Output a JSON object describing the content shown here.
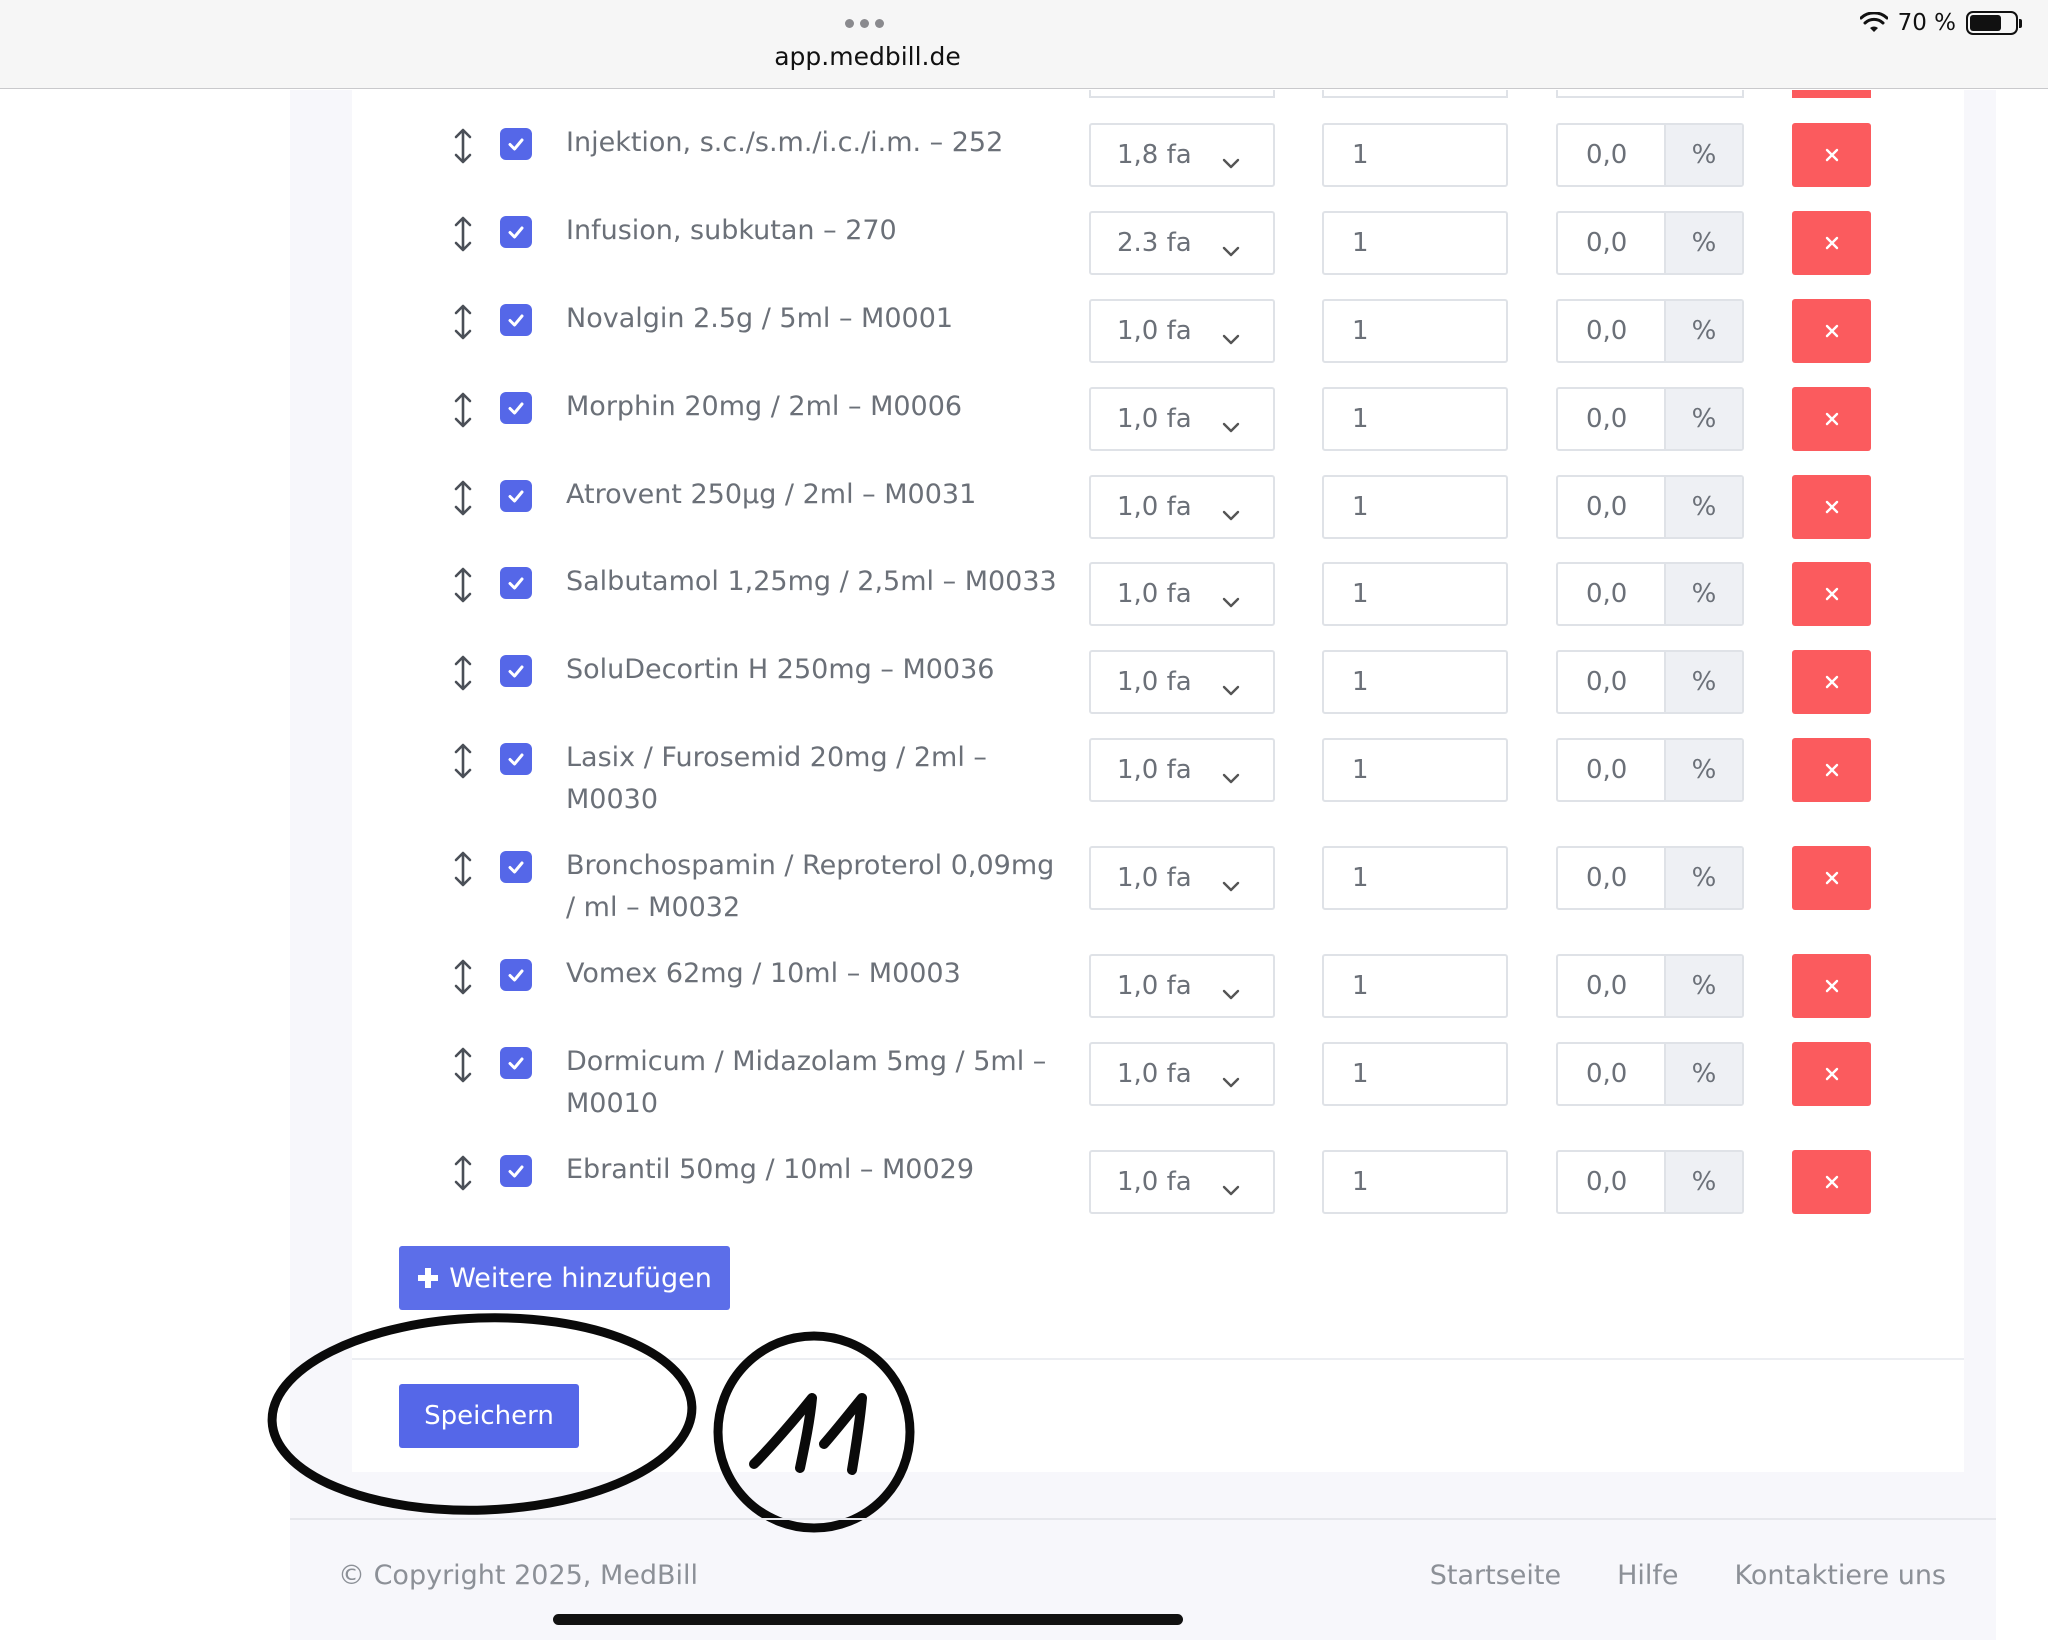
{
  "browser": {
    "url": "app.medbill.de",
    "battery": "70 %",
    "battery_level_pct": 70
  },
  "rows": [
    {
      "label": "Injektion, s.c./s.m./i.c./i.m. – 252",
      "factor": "1,8 fa",
      "quantity": "1",
      "discount": "0,0",
      "unit": "%"
    },
    {
      "label": "Infusion, subkutan – 270",
      "factor": "2.3 fa",
      "quantity": "1",
      "discount": "0,0",
      "unit": "%"
    },
    {
      "label": "Novalgin 2.5g / 5ml – M0001",
      "factor": "1,0 fa",
      "quantity": "1",
      "discount": "0,0",
      "unit": "%"
    },
    {
      "label": "Morphin 20mg / 2ml – M0006",
      "factor": "1,0 fa",
      "quantity": "1",
      "discount": "0,0",
      "unit": "%"
    },
    {
      "label": "Atrovent 250µg / 2ml – M0031",
      "factor": "1,0 fa",
      "quantity": "1",
      "discount": "0,0",
      "unit": "%"
    },
    {
      "label": "Salbutamol 1,25mg / 2,5ml – M0033",
      "factor": "1,0 fa",
      "quantity": "1",
      "discount": "0,0",
      "unit": "%"
    },
    {
      "label": "SoluDecortin H 250mg – M0036",
      "factor": "1,0 fa",
      "quantity": "1",
      "discount": "0,0",
      "unit": "%"
    },
    {
      "label": "Lasix / Furosemid 20mg / 2ml – M0030",
      "factor": "1,0 fa",
      "quantity": "1",
      "discount": "0,0",
      "unit": "%"
    },
    {
      "label": "Bronchospamin / Reproterol 0,09mg / ml – M0032",
      "factor": "1,0 fa",
      "quantity": "1",
      "discount": "0,0",
      "unit": "%"
    },
    {
      "label": "Vomex 62mg / 10ml – M0003",
      "factor": "1,0 fa",
      "quantity": "1",
      "discount": "0,0",
      "unit": "%"
    },
    {
      "label": "Dormicum / Midazolam 5mg / 5ml – M0010",
      "factor": "1,0 fa",
      "quantity": "1",
      "discount": "0,0",
      "unit": "%"
    },
    {
      "label": "Ebrantil 50mg / 10ml – M0029",
      "factor": "1,0 fa",
      "quantity": "1",
      "discount": "0,0",
      "unit": "%"
    }
  ],
  "actions": {
    "add_more_label": "Weitere hinzufügen",
    "save_label": "Speichern"
  },
  "annotation": {
    "step_number": "11"
  },
  "footer": {
    "copyright": "© Copyright 2025, MedBill",
    "links": [
      "Startseite",
      "Hilfe",
      "Kontaktiere uns"
    ]
  },
  "colors": {
    "primary": "#5567e8",
    "danger": "#fb5b5e",
    "text_muted": "#6b7078"
  }
}
